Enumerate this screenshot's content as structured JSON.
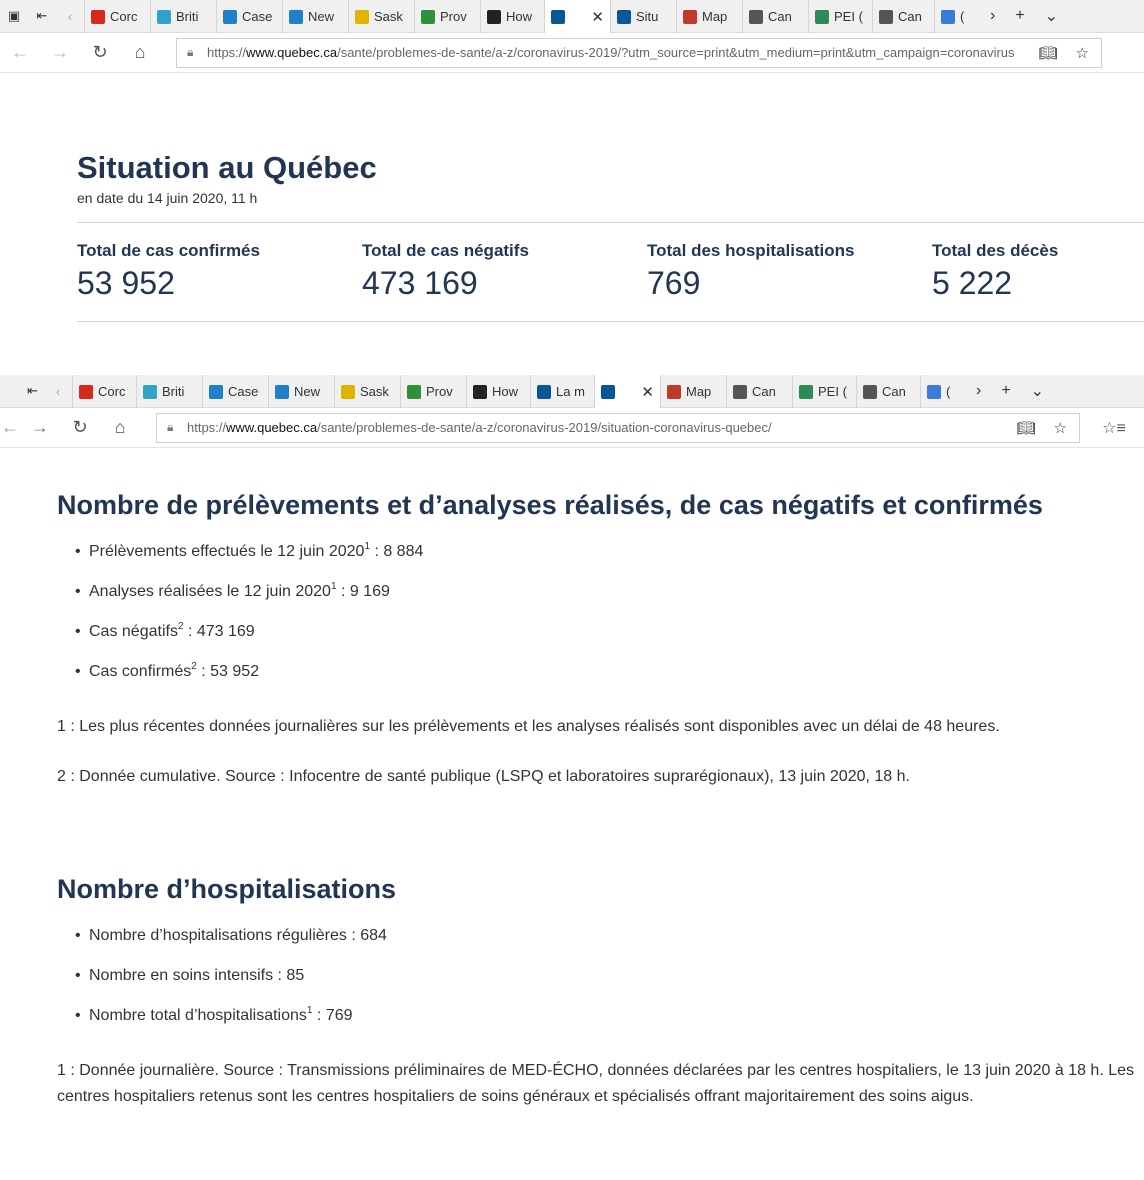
{
  "browser": {
    "tabs_top": [
      {
        "label": "Corc",
        "color": "#d52b1e"
      },
      {
        "label": "Briti",
        "color": "#2fa4c6"
      },
      {
        "label": "Case",
        "color": "#1f80c9"
      },
      {
        "label": "New",
        "color": "#1f80c9"
      },
      {
        "label": "Sask",
        "color": "#e0b400"
      },
      {
        "label": "Prov",
        "color": "#2f8f3a"
      },
      {
        "label": "How",
        "color": "#222222"
      },
      {
        "label": "",
        "color": "#095797",
        "active": true
      },
      {
        "label": "Situ",
        "color": "#095797"
      },
      {
        "label": "Map",
        "color": "#c0392b"
      },
      {
        "label": "Can",
        "color": "#555555"
      },
      {
        "label": "PEI (",
        "color": "#2e8b57"
      },
      {
        "label": "Can",
        "color": "#555555"
      },
      {
        "label": "(",
        "color": "#3a7bd5"
      }
    ],
    "tabs_bottom": [
      {
        "label": "Corc",
        "color": "#d52b1e"
      },
      {
        "label": "Briti",
        "color": "#2fa4c6"
      },
      {
        "label": "Case",
        "color": "#1f80c9"
      },
      {
        "label": "New",
        "color": "#1f80c9"
      },
      {
        "label": "Sask",
        "color": "#e0b400"
      },
      {
        "label": "Prov",
        "color": "#2f8f3a"
      },
      {
        "label": "How",
        "color": "#222222"
      },
      {
        "label": "La m",
        "color": "#095797"
      },
      {
        "label": "",
        "color": "#095797",
        "active": true
      },
      {
        "label": "Map",
        "color": "#c0392b"
      },
      {
        "label": "Can",
        "color": "#555555"
      },
      {
        "label": "PEI (",
        "color": "#2e8b57"
      },
      {
        "label": "Can",
        "color": "#555555"
      },
      {
        "label": "(",
        "color": "#3a7bd5"
      }
    ],
    "url1": {
      "prefix": "https://",
      "host": "www.quebec.ca",
      "path": "/sante/problemes-de-sante/a-z/coronavirus-2019/?utm_source=print&utm_medium=print&utm_campaign=coronavirus"
    },
    "url2": {
      "prefix": "https://",
      "host": "www.quebec.ca",
      "path": "/sante/problemes-de-sante/a-z/coronavirus-2019/situation-coronavirus-quebec/"
    }
  },
  "situation": {
    "title": "Situation au Québec",
    "date": "en date du 14 juin 2020, 11 h",
    "stats": [
      {
        "label": "Total de cas confirmés",
        "value": "53 952"
      },
      {
        "label": "Total de cas négatifs",
        "value": "473 169"
      },
      {
        "label": "Total des hospitalisations",
        "value": "769"
      },
      {
        "label": "Total des décès",
        "value": "5 222"
      }
    ]
  },
  "tests": {
    "title": "Nombre de prélèvements et d’analyses réalisés, de cas négatifs et confirmés",
    "items": [
      {
        "text": "Prélèvements effectués le 12 juin 2020",
        "sup": "1",
        "value": " : 8 884"
      },
      {
        "text": "Analyses réalisées le 12 juin 2020",
        "sup": "1",
        "value": " : 9 169"
      },
      {
        "text": "Cas négatifs",
        "sup": "2",
        "value": " : 473 169"
      },
      {
        "text": "Cas confirmés",
        "sup": "2",
        "value": " : 53 952"
      }
    ],
    "note1": "1 : Les plus récentes données journalières sur les prélèvements et les analyses réalisés sont disponibles avec un délai de 48 heures.",
    "note2": "2 : Donnée cumulative. Source : Infocentre de santé publique (LSPQ et laboratoires suprarégionaux), 13 juin 2020, 18 h."
  },
  "hosp": {
    "title": "Nombre d’hospitalisations",
    "items": [
      {
        "text": "Nombre d’hospitalisations régulières : 684",
        "sup": "",
        "value": ""
      },
      {
        "text": "Nombre en soins intensifs : 85",
        "sup": "",
        "value": ""
      },
      {
        "text": "Nombre total d’hospitalisations",
        "sup": "1",
        "value": " : 769"
      }
    ],
    "note": "1 : Donnée journalière. Source : Transmissions préliminaires de MED-ÉCHO, données déclarées par les centres hospitaliers, le 13 juin 2020 à 18 h. Les centres hospitaliers retenus sont les centres hospitaliers de soins généraux et spécialisés offrant majoritairement des soins aigus."
  }
}
